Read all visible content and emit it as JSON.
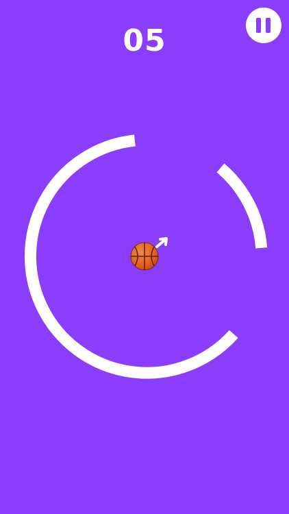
{
  "hud": {
    "score": "05",
    "pause_icon": "pause-icon"
  },
  "colors": {
    "background": "#8a3dfa",
    "ring": "#ffffff",
    "pause_glyph": "#8a3dfa",
    "ball": "#e8662b",
    "ball_seam": "#5a2410"
  },
  "game": {
    "ring_segments": 2,
    "ball_icon": "basketball-icon",
    "direction_icon": "arrow-up-right-icon"
  }
}
